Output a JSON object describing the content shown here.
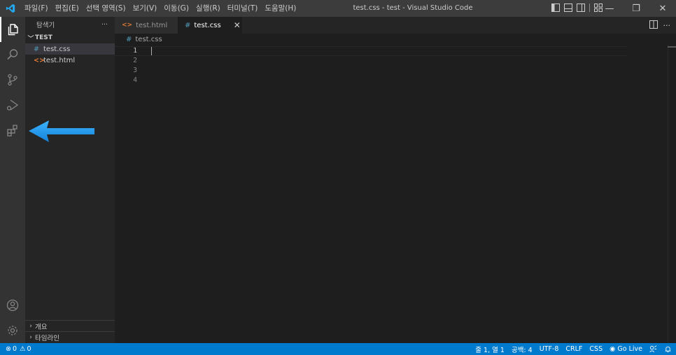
{
  "titlebar": {
    "menu": [
      "파일(F)",
      "편집(E)",
      "선택 영역(S)",
      "보기(V)",
      "이동(G)",
      "실행(R)",
      "터미널(T)",
      "도움말(H)"
    ],
    "window_title": "test.css - test - Visual Studio Code",
    "controls": {
      "minimize": "—",
      "restore": "❐",
      "close": "✕"
    }
  },
  "activitybar": {
    "items": [
      "files-icon",
      "search-icon",
      "source-control-icon",
      "run-debug-icon",
      "extensions-icon"
    ],
    "bottom": [
      "account-icon",
      "settings-gear-icon"
    ]
  },
  "sidebar": {
    "title": "탐색기",
    "more": "···",
    "folder": "TEST",
    "files": [
      {
        "icon": "#",
        "name": "test.css",
        "selected": true
      },
      {
        "icon": "<>",
        "name": "test.html",
        "selected": false
      }
    ],
    "outline": "개요",
    "timeline": "타임라인"
  },
  "tabs": [
    {
      "icon": "<>",
      "label": "test.html",
      "active": false
    },
    {
      "icon": "#",
      "label": "test.css",
      "active": true,
      "close": "✕"
    }
  ],
  "editor_actions": {
    "split": "split-editor-icon",
    "more": "···"
  },
  "breadcrumb": {
    "icon": "#",
    "file": "test.css"
  },
  "editor": {
    "line_numbers": [
      "1",
      "2",
      "3",
      "4"
    ],
    "current_line": 1
  },
  "statusbar": {
    "errors": "0",
    "warnings": "0",
    "position": "줄 1, 열 1",
    "spaces": "공백: 4",
    "encoding": "UTF-8",
    "eol": "CRLF",
    "language": "CSS",
    "golive": "Go Live"
  },
  "colors": {
    "accent": "#007acc",
    "annotation_arrow": "#1e9ee6",
    "css_icon": "#519aba",
    "html_icon": "#e37933"
  }
}
